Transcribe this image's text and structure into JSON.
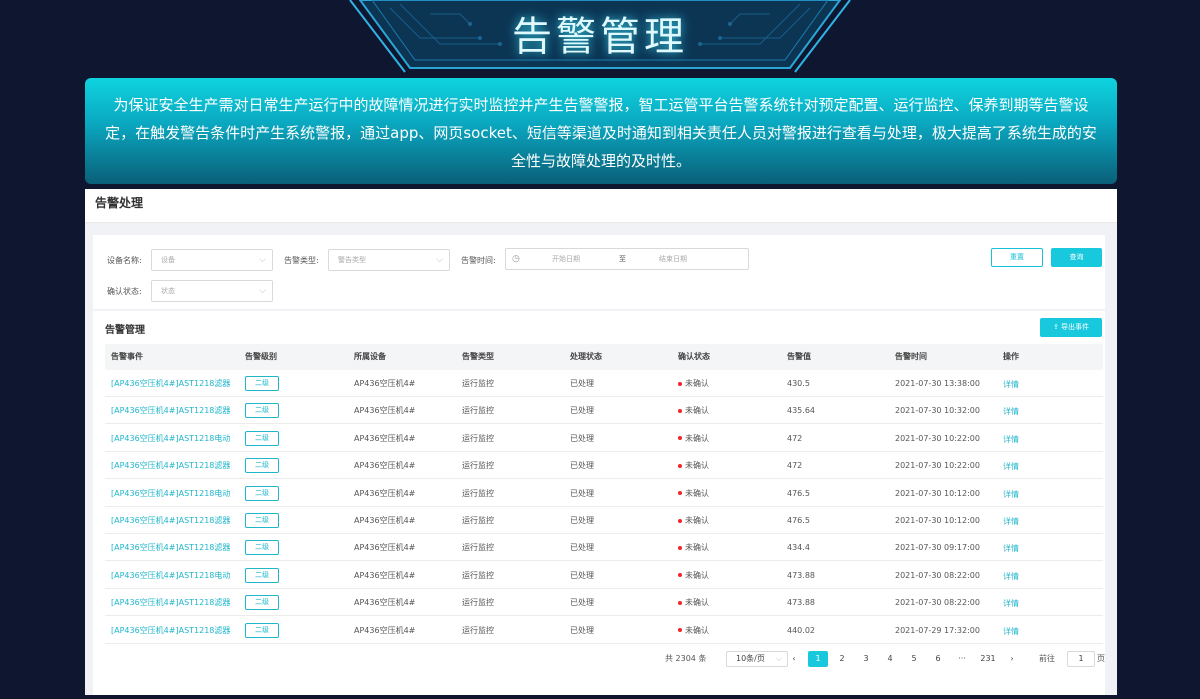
{
  "hero": {
    "title": "告警管理"
  },
  "banner": {
    "text": "为保证安全生产需对日常生产运行中的故障情况进行实时监控并产生告警警报，智工运管平台告警系统针对预定配置、运行监控、保养到期等告警设定，在触发警告条件时产生系统警报，通过app、网页socket、短信等渠道及时通知到相关责任人员对警报进行查看与处理，极大提高了系统生成的安全性与故障处理的及时性。"
  },
  "panel": {
    "title": "告警处理"
  },
  "filters": {
    "device_label": "设备名称:",
    "device_placeholder": "设备",
    "type_label": "告警类型:",
    "type_placeholder": "警告类型",
    "time_label": "告警时间:",
    "start_placeholder": "开始日期",
    "to": "至",
    "end_placeholder": "结束日期",
    "confirm_label": "确认状态:",
    "confirm_placeholder": "状态",
    "reset": "重置",
    "query": "查询"
  },
  "table_section": {
    "title": "告警管理",
    "export": "导出事件"
  },
  "columns": [
    "告警事件",
    "告警级别",
    "所属设备",
    "告警类型",
    "处理状态",
    "确认状态",
    "告警值",
    "告警时间",
    "操作"
  ],
  "rows": [
    {
      "event": "[AP436空压机4#]AST1218滤器",
      "level": "二级",
      "device": "AP436空压机4#",
      "type": "运行监控",
      "handle": "已处理",
      "confirm": "未确认",
      "value": "430.5",
      "time": "2021-07-30 13:38:00",
      "op": "详情"
    },
    {
      "event": "[AP436空压机4#]AST1218滤器",
      "level": "二级",
      "device": "AP436空压机4#",
      "type": "运行监控",
      "handle": "已处理",
      "confirm": "未确认",
      "value": "435.64",
      "time": "2021-07-30 10:32:00",
      "op": "详情"
    },
    {
      "event": "[AP436空压机4#]AST1218电动",
      "level": "二级",
      "device": "AP436空压机4#",
      "type": "运行监控",
      "handle": "已处理",
      "confirm": "未确认",
      "value": "472",
      "time": "2021-07-30 10:22:00",
      "op": "详情"
    },
    {
      "event": "[AP436空压机4#]AST1218滤器",
      "level": "二级",
      "device": "AP436空压机4#",
      "type": "运行监控",
      "handle": "已处理",
      "confirm": "未确认",
      "value": "472",
      "time": "2021-07-30 10:22:00",
      "op": "详情"
    },
    {
      "event": "[AP436空压机4#]AST1218电动",
      "level": "二级",
      "device": "AP436空压机4#",
      "type": "运行监控",
      "handle": "已处理",
      "confirm": "未确认",
      "value": "476.5",
      "time": "2021-07-30 10:12:00",
      "op": "详情"
    },
    {
      "event": "[AP436空压机4#]AST1218滤器",
      "level": "二级",
      "device": "AP436空压机4#",
      "type": "运行监控",
      "handle": "已处理",
      "confirm": "未确认",
      "value": "476.5",
      "time": "2021-07-30 10:12:00",
      "op": "详情"
    },
    {
      "event": "[AP436空压机4#]AST1218滤器",
      "level": "二级",
      "device": "AP436空压机4#",
      "type": "运行监控",
      "handle": "已处理",
      "confirm": "未确认",
      "value": "434.4",
      "time": "2021-07-30 09:17:00",
      "op": "详情"
    },
    {
      "event": "[AP436空压机4#]AST1218电动",
      "level": "二级",
      "device": "AP436空压机4#",
      "type": "运行监控",
      "handle": "已处理",
      "confirm": "未确认",
      "value": "473.88",
      "time": "2021-07-30 08:22:00",
      "op": "详情"
    },
    {
      "event": "[AP436空压机4#]AST1218滤器",
      "level": "二级",
      "device": "AP436空压机4#",
      "type": "运行监控",
      "handle": "已处理",
      "confirm": "未确认",
      "value": "473.88",
      "time": "2021-07-30 08:22:00",
      "op": "详情"
    },
    {
      "event": "[AP436空压机4#]AST1218滤器",
      "level": "二级",
      "device": "AP436空压机4#",
      "type": "运行监控",
      "handle": "已处理",
      "confirm": "未确认",
      "value": "440.02",
      "time": "2021-07-29 17:32:00",
      "op": "详情"
    }
  ],
  "pagination": {
    "total": "共 2304 条",
    "page_size": "10条/页",
    "prev": "‹",
    "next": "›",
    "pages": [
      "1",
      "2",
      "3",
      "4",
      "5",
      "6"
    ],
    "ellipsis": "···",
    "last": "231",
    "goto_label": "前往",
    "goto_value": "1",
    "goto_suffix": "页",
    "current": 1
  },
  "colors": {
    "accent": "#18c8dc",
    "danger": "#f5222d",
    "background": "#0f1730"
  },
  "icons": {
    "select": "chevron-down-icon",
    "clock": "clock-icon",
    "export": "upload-icon"
  }
}
